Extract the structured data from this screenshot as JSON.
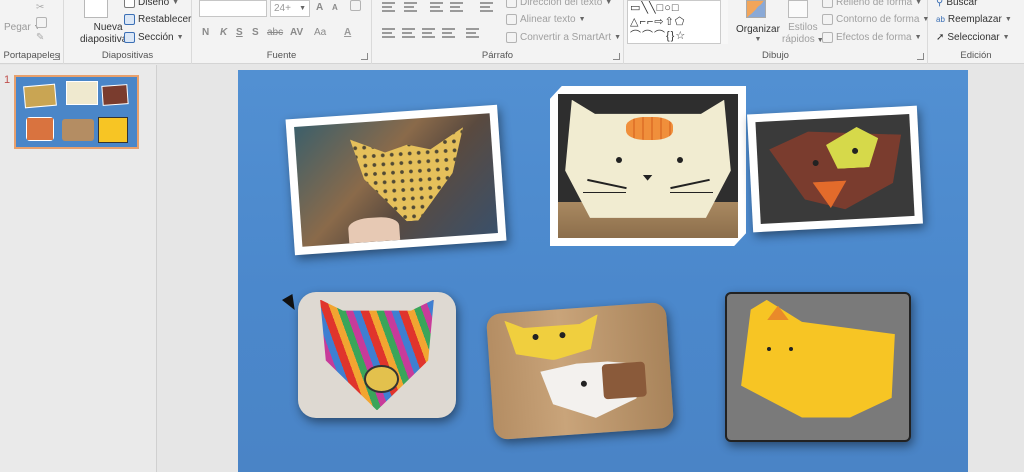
{
  "ribbon": {
    "portapapeles": {
      "paste_label": "Pegar",
      "group_label": "Portapapeles"
    },
    "diapositivas": {
      "new_slide_label": "Nueva",
      "new_slide_label2": "diapositiva",
      "layout_label": "Diseño",
      "reset_label": "Restablecer",
      "section_label": "Sección",
      "group_label": "Diapositivas"
    },
    "fuente": {
      "font_size": "24+",
      "bold": "N",
      "italic": "K",
      "underline": "S",
      "shadow": "S",
      "strike": "abc",
      "spacing": "AV",
      "case": "Aa",
      "grow": "A",
      "shrink": "A",
      "color": "A",
      "group_label": "Fuente"
    },
    "parrafo": {
      "text_direction": "Dirección del texto",
      "align_text": "Alinear texto",
      "smartart": "Convertir a SmartArt",
      "group_label": "Párrafo"
    },
    "dibujo": {
      "shapes_row1": "▭╲╲□○□",
      "shapes_row2": "△⌐⌐⇨⇧⬠",
      "shapes_row3": "⌒⌒⌒{}☆",
      "arrange_label": "Organizar",
      "styles_label": "Estilos",
      "styles_label2": "rápidos",
      "fill_label": "Relleno de forma",
      "outline_label": "Contorno de forma",
      "effects_label": "Efectos de forma",
      "group_label": "Dibujo"
    },
    "edicion": {
      "find_label": "Buscar",
      "replace_label": "Reemplazar",
      "select_label": "Seleccionar",
      "group_label": "Edición"
    }
  },
  "thumbnails": {
    "slide_number": "1"
  },
  "colors": {
    "slide_bg": "#4b88cc",
    "accent": "#e8a06c"
  }
}
